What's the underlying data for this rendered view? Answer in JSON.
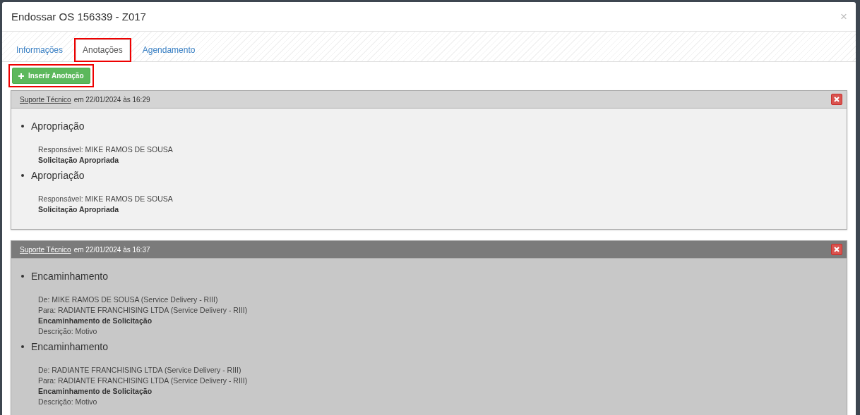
{
  "window": {
    "title": "Endossar OS 156339 - Z017",
    "close": "×"
  },
  "tabs": [
    {
      "label": "Informações",
      "selected": false,
      "highlighted": false
    },
    {
      "label": "Anotações",
      "selected": true,
      "highlighted": true
    },
    {
      "label": "Agendamento",
      "selected": false,
      "highlighted": false
    }
  ],
  "insert_button": {
    "label": "Inserir Anotação",
    "highlighted": true
  },
  "notes": [
    {
      "author": "Suporte Técnico",
      "when": "em 22/01/2024 às 16:29",
      "highlighted": false,
      "entries": [
        {
          "title": "Apropriação",
          "lines": [
            {
              "text": "Responsável: MIKE RAMOS DE SOUSA",
              "bold": false
            },
            {
              "text": "Solicitação Apropriada",
              "bold": true
            }
          ]
        },
        {
          "title": "Apropriação",
          "lines": [
            {
              "text": "Responsável: MIKE RAMOS DE SOUSA",
              "bold": false
            },
            {
              "text": "Solicitação Apropriada",
              "bold": true
            }
          ]
        }
      ]
    },
    {
      "author": "Suporte Técnico",
      "when": "em 22/01/2024 às 16:37",
      "highlighted": true,
      "entries": [
        {
          "title": "Encaminhamento",
          "lines": [
            {
              "text": "De: MIKE RAMOS DE SOUSA (Service Delivery - RIII)",
              "bold": false
            },
            {
              "text": "Para: RADIANTE FRANCHISING LTDA (Service Delivery - RIII)",
              "bold": false
            },
            {
              "text": "Encaminhamento de Solicitação",
              "bold": true
            },
            {
              "text": "Descrição: Motivo",
              "bold": false
            }
          ]
        },
        {
          "title": "Encaminhamento",
          "lines": [
            {
              "text": "De: RADIANTE FRANCHISING LTDA (Service Delivery - RIII)",
              "bold": false
            },
            {
              "text": "Para: RADIANTE FRANCHISING LTDA (Service Delivery - RIII)",
              "bold": false
            },
            {
              "text": "Encaminhamento de Solicitação",
              "bold": true
            },
            {
              "text": "Descrição: Motivo",
              "bold": false
            }
          ]
        }
      ]
    }
  ]
}
